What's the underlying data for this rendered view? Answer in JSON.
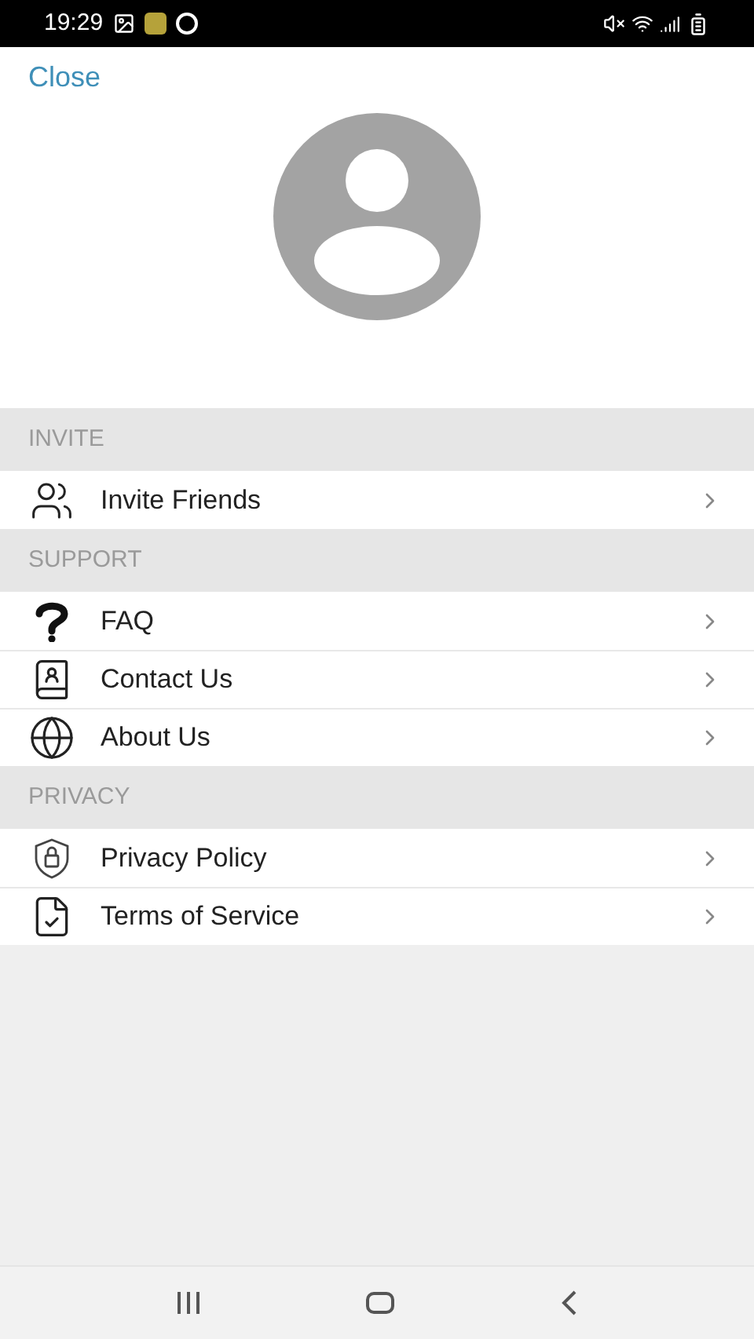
{
  "status_bar": {
    "time": "19:29"
  },
  "close": "Close",
  "sections": [
    {
      "title": "INVITE",
      "items": [
        {
          "label": "Invite Friends"
        }
      ]
    },
    {
      "title": "SUPPORT",
      "items": [
        {
          "label": "FAQ"
        },
        {
          "label": "Contact Us"
        },
        {
          "label": "About Us"
        }
      ]
    },
    {
      "title": "PRIVACY",
      "items": [
        {
          "label": "Privacy Policy"
        },
        {
          "label": "Terms of Service"
        }
      ]
    }
  ]
}
